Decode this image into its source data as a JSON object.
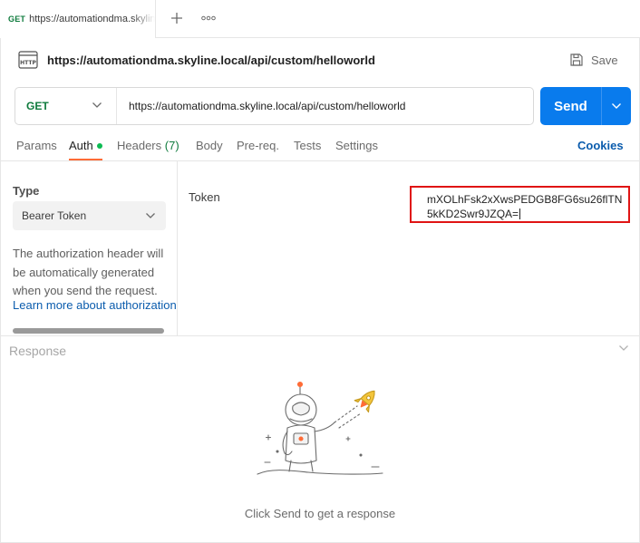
{
  "tab": {
    "method": "GET",
    "title": "https://automationdma.skyline.local/api/custom/helloworld"
  },
  "tabbar": {
    "new_tab_icon": "plus-icon",
    "more_icon": "ellipsis-icon"
  },
  "request": {
    "icon": "http-icon",
    "title": "https://automationdma.skyline.local/api/custom/helloworld",
    "save_label": "Save",
    "method": "GET",
    "url": "https://automationdma.skyline.local/api/custom/helloworld",
    "send_label": "Send"
  },
  "request_tabs": [
    {
      "label": "Params"
    },
    {
      "label": "Auth",
      "active": true,
      "indicator": "green-dot"
    },
    {
      "label": "Headers",
      "count": "(7)"
    },
    {
      "label": "Body"
    },
    {
      "label": "Pre-req."
    },
    {
      "label": "Tests"
    },
    {
      "label": "Settings"
    }
  ],
  "cookies_label": "Cookies",
  "auth": {
    "type_label": "Type",
    "type_value": "Bearer Token",
    "description": "The authorization header will be automatically generated when you send the request.",
    "learn_more": "Learn more about authorization",
    "token_label": "Token",
    "token_value": "mXOLhFsk2xXwsPEDGB8FG6su26flTN5kKD2Swr9JZQA="
  },
  "response": {
    "title": "Response",
    "empty_hint": "Click Send to get a response",
    "illustration": "astronaut-rocket-illustration"
  },
  "colors": {
    "accent": "#ff6c37",
    "send": "#097bed",
    "get_method": "#0f7b3d",
    "link": "#0b5cad",
    "highlight_border": "#e01414"
  }
}
